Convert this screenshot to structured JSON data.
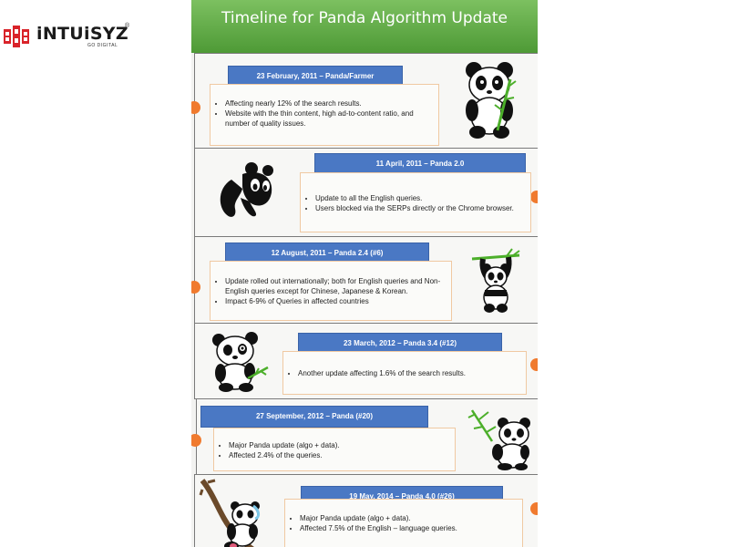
{
  "logo": {
    "name": "iNTUiSYZ",
    "tagline": "GO DIGITAL",
    "reg": "®"
  },
  "infographic": {
    "title": "Timeline for Panda Algorithm Update",
    "header_color": "#5aa63f",
    "date_color": "#4a78c4",
    "accent_color": "#f07a2e"
  },
  "entries": [
    {
      "date": "23 February, 2011 – Panda/Farmer",
      "bullets": [
        "Affecting nearly 12% of the search results.",
        "Website with the thin content, high ad-to-content ratio, and number of quality issues."
      ],
      "icon": "panda-holding-bamboo-icon"
    },
    {
      "date": "11 April, 2011 – Panda 2.0",
      "bullets": [
        "Update to all the English queries.",
        "Users blocked via the SERPs directly or the Chrome browser."
      ],
      "icon": "panda-logo-icon"
    },
    {
      "date": "12 August, 2011 – Panda 2.4 (#6)",
      "bullets": [
        "Update rolled out internationally; both for English queries and Non-English queries except for Chinese, Japanese & Korean.",
        " Impact 6-9% of Queries in affected countries"
      ],
      "icon": "panda-hanging-icon"
    },
    {
      "date": "23 March, 2012 – Panda 3.4 (#12)",
      "bullets": [
        "Another update affecting 1.6% of the search results."
      ],
      "icon": "panda-sitting-icon"
    },
    {
      "date": "27 September, 2012 – Panda (#20)",
      "bullets": [
        "Major Panda update (algo + data).",
        "Affected 2.4% of the queries."
      ],
      "icon": "panda-bamboo-icon"
    },
    {
      "date": "19 May, 2014  – Panda 4.0 (#26)",
      "bullets": [
        "Major Panda update (algo + data).",
        "Affected 7.5% of the English – language queries."
      ],
      "icon": "panda-in-tree-icon"
    }
  ]
}
